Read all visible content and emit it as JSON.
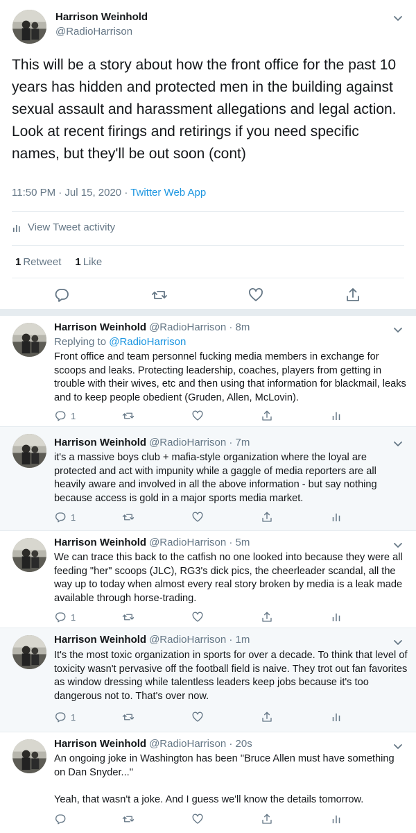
{
  "main_tweet": {
    "name": "Harrison Weinhold",
    "handle": "@RadioHarrison",
    "text": "This will be a story about how the front office for the past 10 years has hidden and protected men in the building against sexual assault and harassment allegations and legal action. Look at recent firings and retirings if you need specific names, but they'll be out soon (cont)",
    "timestamp": "11:50 PM · Jul 15, 2020 · ",
    "app": "Twitter Web App",
    "activity_label": "View Tweet activity",
    "retweet_count": "1",
    "retweet_label": "Retweet",
    "like_count": "1",
    "like_label": "Like"
  },
  "replies": [
    {
      "name": "Harrison Weinhold",
      "handle_time": "@RadioHarrison · 8m",
      "replying_prefix": "Replying to ",
      "replying_to": "@RadioHarrison",
      "text": "Front office and team personnel fucking media members in exchange for scoops and leaks. Protecting leadership, coaches, players from getting in trouble with their wives, etc and then using that information for blackmail, leaks and to keep people obedient (Gruden, Allen, McLovin).",
      "reply_count": "1"
    },
    {
      "name": "Harrison Weinhold",
      "handle_time": "@RadioHarrison · 7m",
      "text": "it's a massive boys club + mafia-style organization where the loyal are protected and act with impunity while a gaggle of media reporters are all heavily aware and involved in all the above information - but say nothing because access is gold in a major sports media market.",
      "reply_count": "1"
    },
    {
      "name": "Harrison Weinhold",
      "handle_time": "@RadioHarrison · 5m",
      "text": "We can trace this back to the catfish no one looked into because they were all feeding \"her\" scoops (JLC), RG3's dick pics, the cheerleader scandal, all the way up to today when almost every real story broken by media is a leak made available through horse-trading.",
      "reply_count": "1"
    },
    {
      "name": "Harrison Weinhold",
      "handle_time": "@RadioHarrison · 1m",
      "text": "It's the most toxic organization in sports for over a decade. To think that level of toxicity wasn't pervasive off the football field is naive. They trot out fan favorites as window dressing while talentless leaders keep jobs because it's too dangerous not to. That's over now.",
      "reply_count": "1"
    },
    {
      "name": "Harrison Weinhold",
      "handle_time": "@RadioHarrison · 20s",
      "text": "An ongoing joke in Washington has been \"Bruce Allen must have something on Dan Snyder...\"\n\nYeah, that wasn't a joke. And I guess we'll know the details tomorrow.",
      "reply_count": ""
    }
  ],
  "icons": [
    "chevron-down-icon",
    "reply-icon",
    "retweet-icon",
    "like-icon",
    "share-icon",
    "analytics-icon"
  ],
  "colors": {
    "link": "#1b95e0",
    "muted": "#657786",
    "text": "#14171a",
    "highlight_bg": "#f5f8fa",
    "border": "#e6ecf0"
  }
}
